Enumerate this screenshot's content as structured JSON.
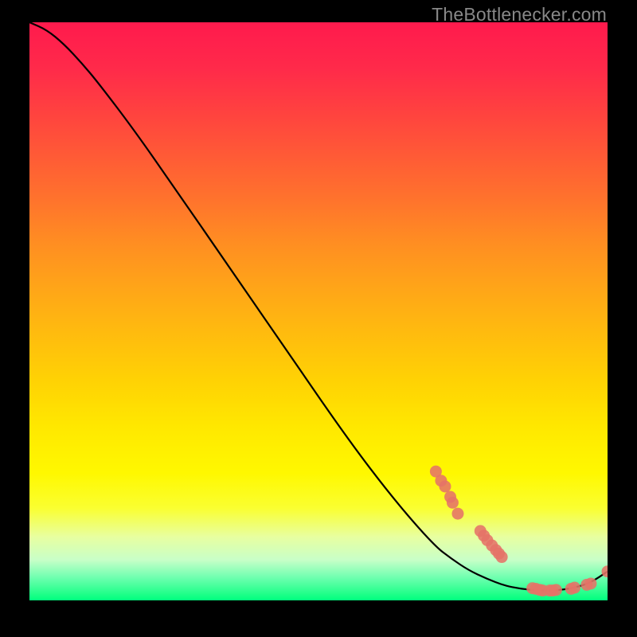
{
  "watermark": "TheBottlenecker.com",
  "chart_data": {
    "type": "line",
    "title": "",
    "xlabel": "",
    "ylabel": "",
    "xlim": [
      0,
      100
    ],
    "ylim": [
      0,
      100
    ],
    "grid": false,
    "curve": [
      {
        "x": 0,
        "y": 100
      },
      {
        "x": 3,
        "y": 98.7
      },
      {
        "x": 6,
        "y": 96.2
      },
      {
        "x": 9,
        "y": 93.0
      },
      {
        "x": 12,
        "y": 89.4
      },
      {
        "x": 18,
        "y": 81.5
      },
      {
        "x": 25,
        "y": 71.5
      },
      {
        "x": 35,
        "y": 57.0
      },
      {
        "x": 45,
        "y": 42.5
      },
      {
        "x": 55,
        "y": 28.0
      },
      {
        "x": 63,
        "y": 17.5
      },
      {
        "x": 70,
        "y": 9.5
      },
      {
        "x": 73,
        "y": 7.2
      },
      {
        "x": 76,
        "y": 5.2
      },
      {
        "x": 79,
        "y": 3.8
      },
      {
        "x": 82,
        "y": 2.6
      },
      {
        "x": 85,
        "y": 2.0
      },
      {
        "x": 88,
        "y": 1.7
      },
      {
        "x": 91,
        "y": 1.7
      },
      {
        "x": 94,
        "y": 2.1
      },
      {
        "x": 97,
        "y": 3.0
      },
      {
        "x": 100,
        "y": 5.0
      }
    ],
    "markers": [
      {
        "x": 70.3,
        "y": 22.3
      },
      {
        "x": 71.2,
        "y": 20.7
      },
      {
        "x": 71.9,
        "y": 19.7
      },
      {
        "x": 72.8,
        "y": 17.9
      },
      {
        "x": 73.2,
        "y": 16.9
      },
      {
        "x": 74.1,
        "y": 15.0
      },
      {
        "x": 78.0,
        "y": 12.0
      },
      {
        "x": 78.6,
        "y": 11.2
      },
      {
        "x": 79.2,
        "y": 10.4
      },
      {
        "x": 80.0,
        "y": 9.5
      },
      {
        "x": 80.7,
        "y": 8.7
      },
      {
        "x": 81.2,
        "y": 8.1
      },
      {
        "x": 81.7,
        "y": 7.5
      },
      {
        "x": 87.0,
        "y": 2.1
      },
      {
        "x": 87.6,
        "y": 2.0
      },
      {
        "x": 88.3,
        "y": 1.8
      },
      {
        "x": 88.8,
        "y": 1.7
      },
      {
        "x": 90.0,
        "y": 1.7
      },
      {
        "x": 90.5,
        "y": 1.7
      },
      {
        "x": 91.1,
        "y": 1.8
      },
      {
        "x": 93.7,
        "y": 2.0
      },
      {
        "x": 94.3,
        "y": 2.2
      },
      {
        "x": 96.4,
        "y": 2.7
      },
      {
        "x": 97.1,
        "y": 2.9
      },
      {
        "x": 100.0,
        "y": 5.0
      }
    ]
  }
}
